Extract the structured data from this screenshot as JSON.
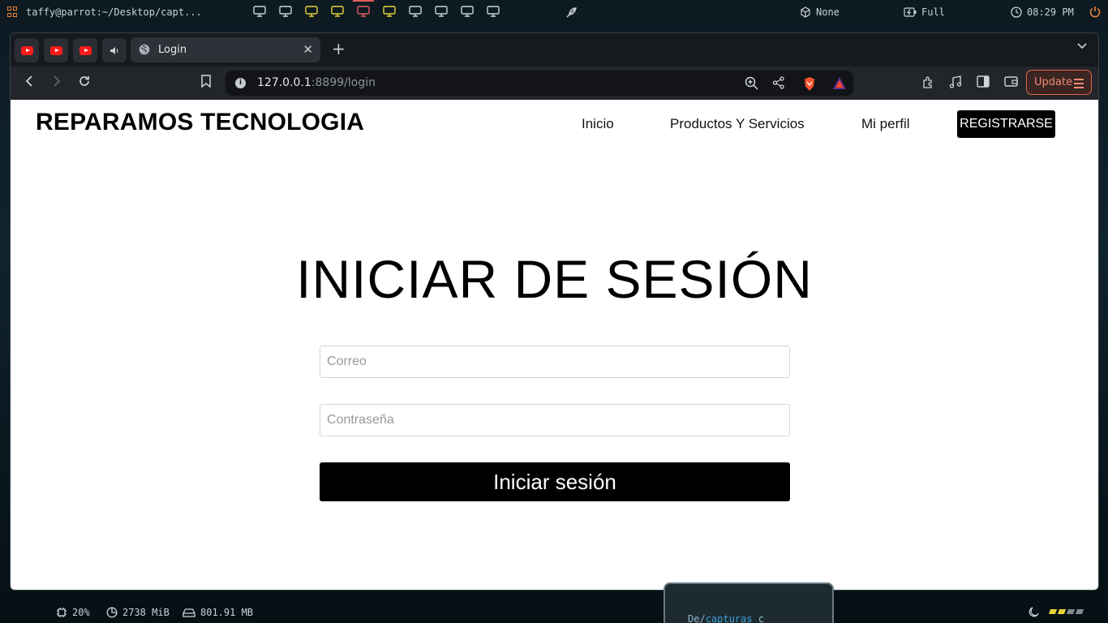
{
  "system_top": {
    "terminal_title": "taffy@parrot:~/Desktop/capt...",
    "layout": "None",
    "power_mode": "Full",
    "time": "08:29 PM"
  },
  "browser": {
    "tab_title": "Login",
    "url_host": "127.0.0.1",
    "url_path": ":8899/login",
    "update_label": "Update"
  },
  "site": {
    "brand": "REPARAMOS TECNOLOGIA",
    "nav": [
      "Inicio",
      "Productos Y Servicios",
      "Mi perfil"
    ],
    "register_label": "REGISTRARSE"
  },
  "login": {
    "title": "INICIAR DE SESIÓN",
    "email_placeholder": "Correo",
    "password_placeholder": "Contraseña",
    "submit_label": "Iniciar sesión"
  },
  "system_bottom": {
    "cpu": "20%",
    "memory": "2738 MiB",
    "disk": "801.91 MB",
    "terminal_dir_short": "De",
    "terminal_dir": "capturas",
    "terminal_suffix": "c"
  },
  "colors": {
    "accent_orange": "#e8833a",
    "update_red": "#e0664d",
    "page_bg": "#ffffff",
    "button_black": "#000000"
  }
}
